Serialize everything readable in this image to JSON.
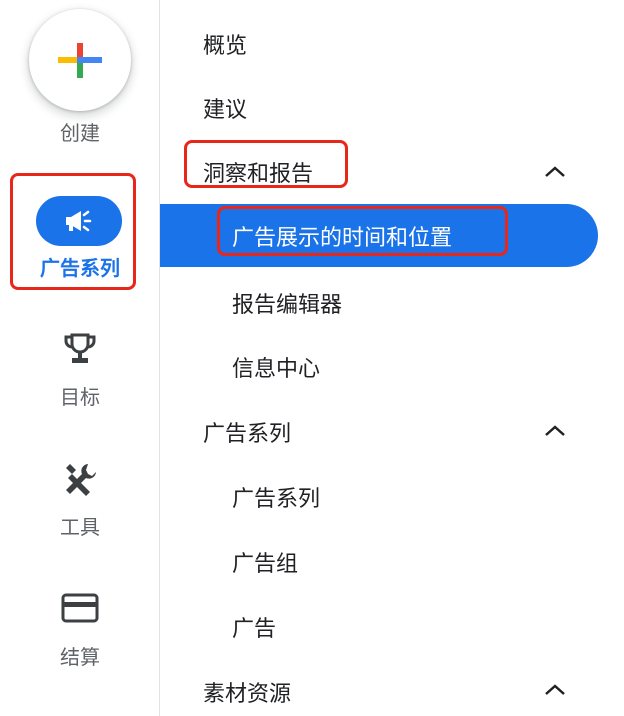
{
  "rail": {
    "create_label": "创建",
    "items": [
      {
        "label": "广告系列",
        "icon": "megaphone-icon",
        "active": true
      },
      {
        "label": "目标",
        "icon": "trophy-icon"
      },
      {
        "label": "工具",
        "icon": "tools-icon"
      },
      {
        "label": "结算",
        "icon": "credit-card-icon"
      }
    ]
  },
  "nav": {
    "overview": "概览",
    "recommendations": "建议",
    "insights": {
      "label": "洞察和报告",
      "children": [
        "广告展示的时间和位置",
        "报告编辑器",
        "信息中心"
      ]
    },
    "campaigns": {
      "label": "广告系列",
      "children": [
        "广告系列",
        "广告组",
        "广告"
      ]
    },
    "assets": {
      "label": "素材资源"
    }
  },
  "colors": {
    "accent": "#1a73e8",
    "highlight_border": "#e8271b",
    "text": "#202124",
    "muted": "#5f6368"
  }
}
